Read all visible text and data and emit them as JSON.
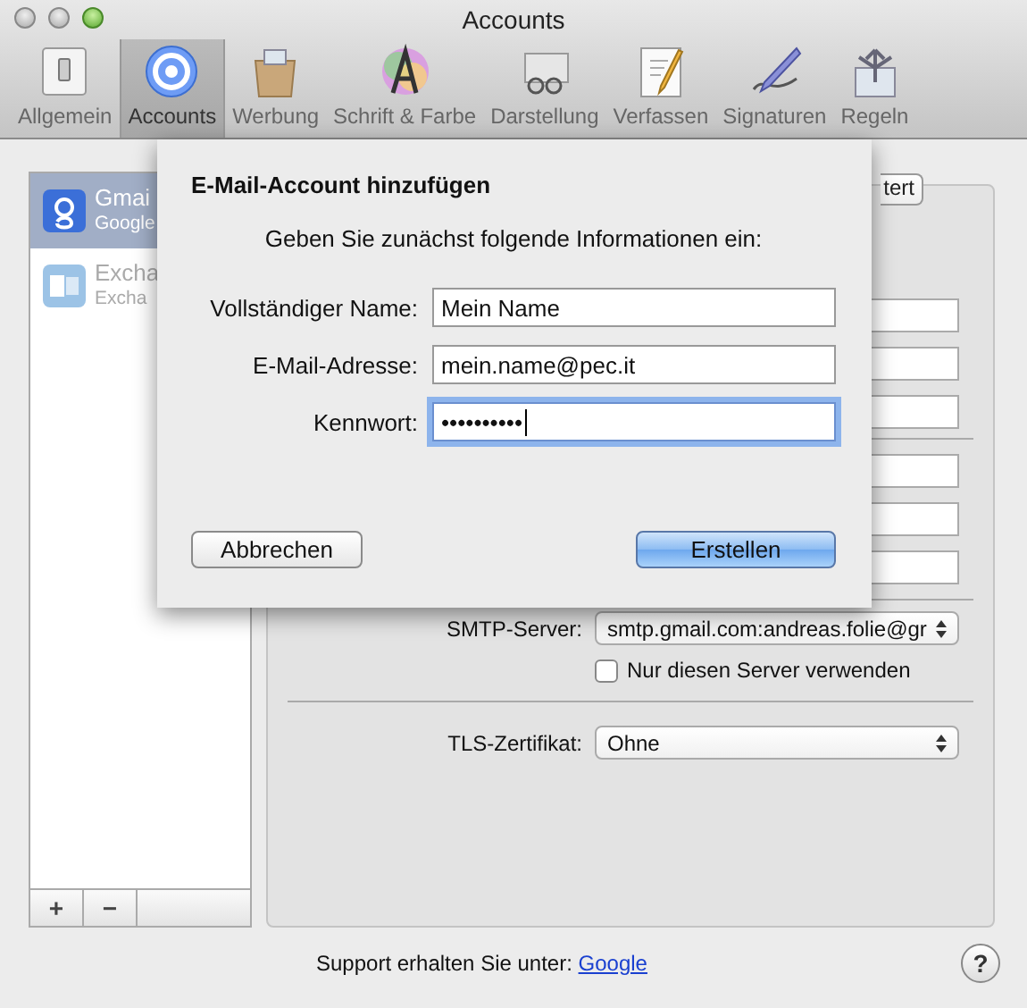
{
  "window": {
    "title": "Accounts"
  },
  "toolbar": [
    {
      "label": "Allgemein",
      "selected": false
    },
    {
      "label": "Accounts",
      "selected": true
    },
    {
      "label": "Werbung",
      "selected": false
    },
    {
      "label": "Schrift & Farbe",
      "selected": false
    },
    {
      "label": "Darstellung",
      "selected": false
    },
    {
      "label": "Verfassen",
      "selected": false
    },
    {
      "label": "Signaturen",
      "selected": false
    },
    {
      "label": "Regeln",
      "selected": false
    }
  ],
  "accounts": [
    {
      "name": "Gmai",
      "type": "Google",
      "selected": true,
      "kind": "google"
    },
    {
      "name": "Excha",
      "type": "Excha",
      "selected": false,
      "kind": "exchange"
    }
  ],
  "list_buttons": [
    "+",
    "−"
  ],
  "account_tabs": [
    {
      "label": "tert",
      "selected": false
    }
  ],
  "smtp_server": {
    "label": "SMTP-Server:",
    "value": "smtp.gmail.com:andreas.folie@gr"
  },
  "only_this_server": {
    "label": "Nur diesen Server verwenden",
    "checked": false
  },
  "tls_certificate": {
    "label": "TLS-Zertifikat:",
    "value": "Ohne"
  },
  "support": {
    "text": "Support erhalten Sie unter:",
    "link": "Google"
  },
  "help_button": "?",
  "sheet": {
    "title": "E-Mail-Account hinzufügen",
    "prompt": "Geben Sie zunächst folgende Informationen ein:",
    "fields": [
      {
        "label": "Vollständiger Name:",
        "value": "Mein Name",
        "focused": false
      },
      {
        "label": "E-Mail-Adresse:",
        "value": "mein.name@pec.it",
        "focused": false
      },
      {
        "label": "Kennwort:",
        "value": "••••••••••",
        "focused": true
      }
    ],
    "buttons": [
      {
        "label": "Abbrechen",
        "default": false
      },
      {
        "label": "Erstellen",
        "default": true
      }
    ]
  }
}
